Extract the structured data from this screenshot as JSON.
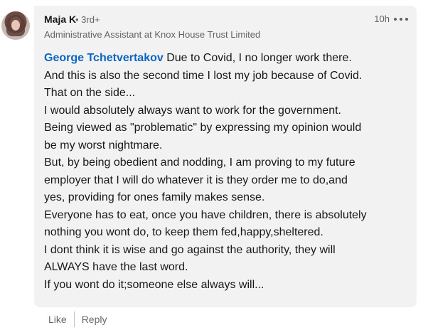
{
  "comment": {
    "author": "Maja K",
    "degree": "• 3rd+",
    "headline": "Administrative Assistant at Knox House Trust Limited",
    "timestamp": "10h",
    "mention": "George Tchetvertakov",
    "lines": [
      " Due to Covid, I no longer work there.",
      "And this is also the second time I lost my job because of Covid.",
      "That on the side...",
      "I would absolutely always want to work for the government.",
      "Being viewed as \"problematic\" by expressing my opinion would",
      "be my worst nightmare.",
      "But, by being obedient and nodding, I am proving to my future",
      "employer that I will do whatever it is they order me to do,and",
      "yes, providing for ones family makes sense.",
      "Everyone has to eat, once you have children, there is absolutely",
      "nothing you wont do, to keep them fed,happy,sheltered.",
      "I dont think it is wise and go against the authority, they will",
      "ALWAYS have the last word.",
      "If you wont do it;someone else always will..."
    ]
  },
  "actions": {
    "like": "Like",
    "reply": "Reply"
  },
  "icons": {
    "more": "more-options-icon"
  },
  "colors": {
    "mention": "#0a66c2",
    "bubble": "#f2f2f2"
  }
}
